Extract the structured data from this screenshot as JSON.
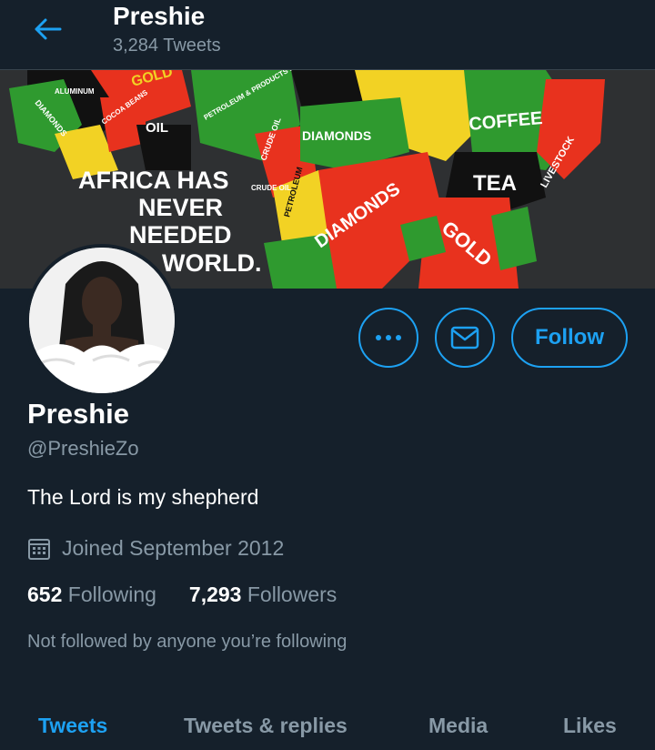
{
  "header": {
    "name": "Preshie",
    "tweet_count": "3,284 Tweets"
  },
  "banner": {
    "headline_lines": [
      "AFRICA HAS",
      "NEVER",
      "NEEDED",
      "WORLD."
    ],
    "map_labels": [
      "GOLD",
      "ALUMINUM",
      "DIAMONDS",
      "COCOA BEANS",
      "OIL",
      "PETROLEUM & PRODUCTS PRODUCTS",
      "CRUDE OIL",
      "DIAMONDS",
      "COFFEE",
      "TEA",
      "LIVESTOCK",
      "CRUDE OIL",
      "PETROLEUM",
      "DIAMONDS",
      "GOLD"
    ],
    "colors": {
      "red": "#e8321e",
      "green": "#2f9a2f",
      "yellow": "#f2d224",
      "black": "#111111"
    }
  },
  "actions": {
    "more_icon": "more-dots-icon",
    "message_icon": "envelope-icon",
    "follow_label": "Follow"
  },
  "profile": {
    "name": "Preshie",
    "handle": "@PreshieZo",
    "bio": "The Lord is my shepherd",
    "joined": "Joined September 2012",
    "following_count": "652",
    "following_label": "Following",
    "followers_count": "7,293",
    "followers_label": "Followers",
    "followed_note": "Not followed by anyone you’re following"
  },
  "tabs": [
    {
      "label": "Tweets",
      "active": true
    },
    {
      "label": "Tweets & replies",
      "active": false
    },
    {
      "label": "Media",
      "active": false
    },
    {
      "label": "Likes",
      "active": false
    }
  ],
  "theme": {
    "background": "#15202b",
    "accent": "#1da1f2",
    "muted": "#8899a6"
  }
}
